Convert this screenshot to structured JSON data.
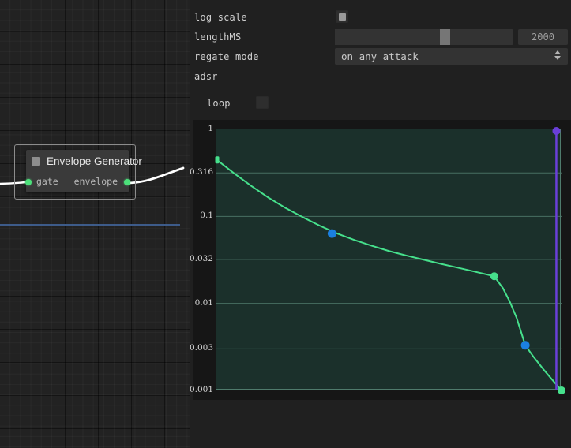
{
  "window": {
    "background": "#202020"
  },
  "canvas": {
    "node": {
      "title": "Envelope Generator",
      "icon": "square-icon",
      "input_port_label": "gate",
      "output_port_label": "envelope",
      "port_color": "#4ce07a",
      "selected": true
    },
    "connection_line_color": "#3f5f8f",
    "wire_color": "#ffffff"
  },
  "panel": {
    "rows": [
      {
        "label": "log scale",
        "type": "checkbox",
        "checked": true
      },
      {
        "label": "lengthMS",
        "type": "slider",
        "value": "2000"
      },
      {
        "label": "regate mode",
        "type": "select",
        "value": "on any attack"
      },
      {
        "label": "adsr",
        "type": "header"
      },
      {
        "label": "loop",
        "type": "checkbox",
        "checked": false
      }
    ],
    "log_scale": {
      "label": "log scale",
      "checked": true
    },
    "length_ms": {
      "label": "lengthMS",
      "value": "2000",
      "slider_fraction": 0.625
    },
    "regate_mode": {
      "label": "regate mode",
      "value": "on any attack",
      "options": [
        "on any attack"
      ]
    },
    "adsr": {
      "label": "adsr"
    },
    "loop": {
      "label": "loop",
      "checked": false
    }
  },
  "chart_data": {
    "type": "line",
    "title": "",
    "xlabel": "",
    "ylabel": "",
    "log_y": true,
    "grid": true,
    "legend": "none",
    "background": "#1b302b",
    "line_color": "#46e08c",
    "handle_color": "#1b7fe0",
    "anchor_color": "#46e08c",
    "playhead_color": "#6a3fd8",
    "ytick_labels": [
      "1",
      "0.316",
      "0.1",
      "0.032",
      "0.01",
      "0.003",
      "0.001"
    ],
    "ytick_values": [
      1,
      0.316,
      0.1,
      0.032,
      0.01,
      0.003,
      0.001
    ],
    "ylim": [
      0.001,
      1
    ],
    "xlim": [
      0,
      1
    ],
    "xgridlines": [
      0.5
    ],
    "playhead_x": 0.985,
    "anchor_points": [
      {
        "x": 0.0,
        "y": 0.45
      },
      {
        "x": 0.805,
        "y": 0.0205
      },
      {
        "x": 1.0,
        "y": 0.001
      }
    ],
    "control_handles": [
      {
        "x": 0.335,
        "y": 0.0635
      },
      {
        "x": 0.895,
        "y": 0.0033
      }
    ],
    "curve": [
      {
        "x": 0.0,
        "y": 0.45
      },
      {
        "x": 0.05,
        "y": 0.315
      },
      {
        "x": 0.1,
        "y": 0.225
      },
      {
        "x": 0.15,
        "y": 0.165
      },
      {
        "x": 0.2,
        "y": 0.125
      },
      {
        "x": 0.25,
        "y": 0.098
      },
      {
        "x": 0.3,
        "y": 0.078
      },
      {
        "x": 0.35,
        "y": 0.0635
      },
      {
        "x": 0.4,
        "y": 0.0535
      },
      {
        "x": 0.45,
        "y": 0.046
      },
      {
        "x": 0.5,
        "y": 0.04
      },
      {
        "x": 0.55,
        "y": 0.0355
      },
      {
        "x": 0.6,
        "y": 0.0318
      },
      {
        "x": 0.65,
        "y": 0.0285
      },
      {
        "x": 0.7,
        "y": 0.0257
      },
      {
        "x": 0.75,
        "y": 0.0231
      },
      {
        "x": 0.805,
        "y": 0.0205
      },
      {
        "x": 0.83,
        "y": 0.015
      },
      {
        "x": 0.85,
        "y": 0.0105
      },
      {
        "x": 0.87,
        "y": 0.0068
      },
      {
        "x": 0.895,
        "y": 0.0033
      },
      {
        "x": 0.92,
        "y": 0.0024
      },
      {
        "x": 0.95,
        "y": 0.0017
      },
      {
        "x": 0.975,
        "y": 0.0013
      },
      {
        "x": 1.0,
        "y": 0.001
      }
    ]
  }
}
